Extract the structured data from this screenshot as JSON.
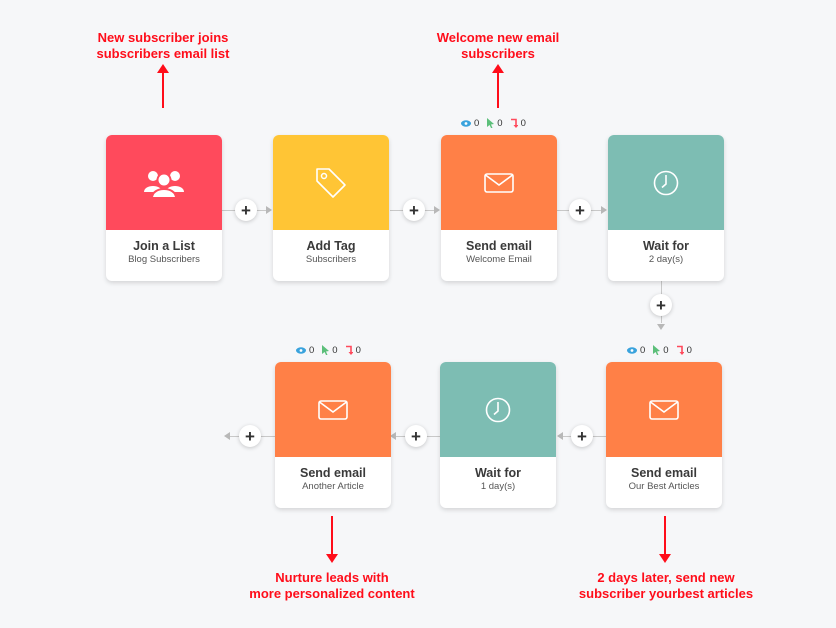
{
  "colors": {
    "trigger": "#ff4a5c",
    "tag": "#ffc535",
    "email": "#ff8047",
    "wait": "#7dbdb3",
    "annotation": "#ff0d1a",
    "stat_views": "#3aa3dd",
    "stat_clicks": "#5cbf7a",
    "stat_bounces": "#ff4a5c"
  },
  "nodes": [
    {
      "id": "join-list",
      "icon": "users-icon",
      "title": "Join a List",
      "subtitle": "Blog Subscribers"
    },
    {
      "id": "add-tag",
      "icon": "tag-icon",
      "title": "Add Tag",
      "subtitle": "Subscribers"
    },
    {
      "id": "send-welcome",
      "icon": "envelope-icon",
      "title": "Send email",
      "subtitle": "Welcome Email",
      "stats": {
        "views": "0",
        "clicks": "0",
        "bounces": "0"
      }
    },
    {
      "id": "wait-2",
      "icon": "clock-icon",
      "title": "Wait for",
      "subtitle": "2 day(s)"
    },
    {
      "id": "send-best",
      "icon": "envelope-icon",
      "title": "Send email",
      "subtitle": "Our Best Articles",
      "stats": {
        "views": "0",
        "clicks": "0",
        "bounces": "0"
      }
    },
    {
      "id": "wait-1",
      "icon": "clock-icon",
      "title": "Wait for",
      "subtitle": "1 day(s)"
    },
    {
      "id": "send-another",
      "icon": "envelope-icon",
      "title": "Send email",
      "subtitle": "Another Article",
      "stats": {
        "views": "0",
        "clicks": "0",
        "bounces": "0"
      }
    }
  ],
  "add_step_label": "+",
  "annotations": {
    "join": [
      "New subscriber joins",
      "subscribers email list"
    ],
    "welcome": [
      "Welcome new email",
      "subscribers"
    ],
    "nurture": [
      "Nurture leads with",
      "more personalized content"
    ],
    "best": [
      "2 days later, send new",
      "subscriber yourbest articles"
    ]
  }
}
